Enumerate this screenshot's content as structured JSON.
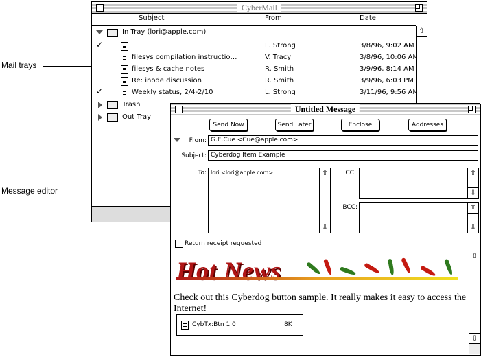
{
  "callouts": {
    "mail_trays": "Mail trays",
    "message_editor": "Message editor"
  },
  "mail_window": {
    "title": "CyberMail",
    "columns": {
      "subject": "Subject",
      "from": "From",
      "date": "Date"
    },
    "in_tray": "In Tray (lori@apple.com)",
    "messages": [
      {
        "checked": true,
        "subject": "",
        "from": "L. Strong",
        "date": "3/8/96, 9:02 AM"
      },
      {
        "checked": false,
        "subject": "filesys compilation instructio…",
        "from": "V. Tracy",
        "date": "3/8/96, 10:06 AM"
      },
      {
        "checked": false,
        "subject": "filesys & cache notes",
        "from": "R. Smith",
        "date": "3/9/96, 8:14 AM"
      },
      {
        "checked": false,
        "subject": "Re: inode discussion",
        "from": "R. Smith",
        "date": "3/9/96, 6:03 PM"
      },
      {
        "checked": true,
        "subject": "Weekly status, 2/4-2/10",
        "from": "L. Strong",
        "date": "3/11/96, 9:56 AM"
      }
    ],
    "trash": "Trash",
    "out_tray": "Out Tray",
    "check_glyph": "✓",
    "scroll_up_glyph": "⇧"
  },
  "message_window": {
    "title": "Untitled Message",
    "buttons": {
      "send_now": "Send Now",
      "send_later": "Send Later",
      "enclose": "Enclose",
      "addresses": "Addresses"
    },
    "labels": {
      "from": "From:",
      "subject": "Subject:",
      "to": "To:",
      "cc": "CC:",
      "bcc": "BCC:"
    },
    "from_value": "G.E.Cue <Cue@apple.com>",
    "subject_value": "Cyberdog Item Example",
    "to_value": "lori <lori@apple.com>",
    "return_receipt": "Return receipt requested",
    "banner_text": "Hot News",
    "body_text": "Check out this Cyberdog button sample. It really makes it easy to access the Internet!",
    "attachment": {
      "name": "CybTx:Btn 1.0",
      "size": "8K"
    },
    "scroll_up_glyph": "⇧",
    "scroll_down_glyph": "⇩"
  },
  "colors": {
    "pepper_red": "#c41a10",
    "pepper_green": "#2f7a1e",
    "banner_red": "#b01515"
  }
}
